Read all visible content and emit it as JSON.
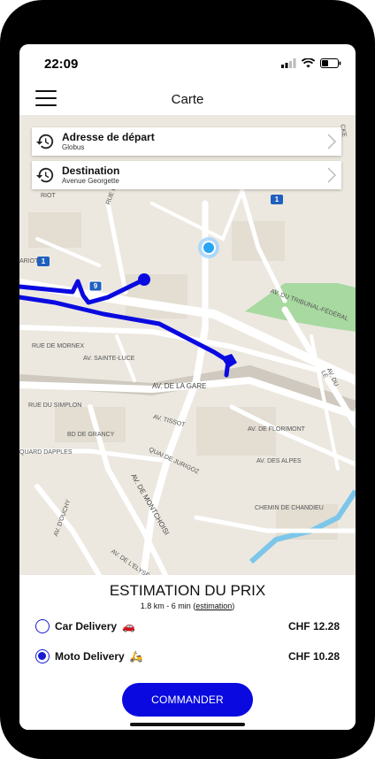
{
  "status_bar": {
    "time": "22:09"
  },
  "header": {
    "title": "Carte",
    "menu_icon": "hamburger-menu-icon"
  },
  "search": {
    "departure": {
      "label": "Adresse de départ",
      "value": "Globus"
    },
    "destination": {
      "label": "Destination",
      "value": "Avenue Georgette"
    }
  },
  "map": {
    "route_color": "#0a0ae0",
    "street_labels": [
      "RUE DU",
      "AV. DU TRIBUNAL-FÉDÉRAL",
      "AV. DU LÉ",
      "RUE DE MORNEX",
      "AV. SAINTE-LUCE",
      "AV. DE LA GARE",
      "RUE DU SIMPLON",
      "AV. TISSOT",
      "BD DE GRANCY",
      "AV. DE FLORIMONT",
      "QUAI DE JURIGOZ",
      "AV. DES ALPES",
      "QUARD DAPPLES",
      "AV. DE MONTCHOISI",
      "AV. D'OUCHY",
      "CHEMIN DE CHANDIEU",
      "AV. DE L'ELYSÉE",
      "RIOT",
      "ARIOT",
      "CKE",
      "RUE DU"
    ],
    "route_badges": [
      "1",
      "9",
      "1"
    ]
  },
  "estimate": {
    "title": "ESTIMATION DU PRIX",
    "distance_time": "1.8 km - 6 min (",
    "link": "estimation",
    "close_paren": ")"
  },
  "options": [
    {
      "label": "Car Delivery",
      "emoji": "🚗",
      "price": "CHF 12.28",
      "selected": false
    },
    {
      "label": "Moto Delivery",
      "emoji": "🛵",
      "price": "CHF 10.28",
      "selected": true
    }
  ],
  "order_button": "COMMANDER",
  "colors": {
    "accent": "#0a0ae0",
    "park": "#a8d9a0",
    "water": "#7cc6ea"
  }
}
